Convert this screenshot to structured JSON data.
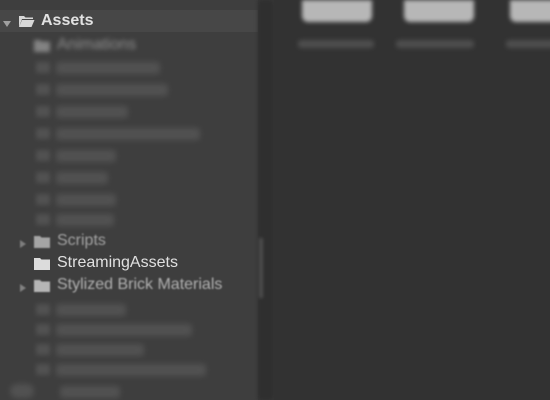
{
  "project_tree": {
    "root": {
      "label": "Assets",
      "expanded": true
    },
    "items": [
      {
        "label": "Animations",
        "blurred": true
      },
      {
        "label": "Scripts",
        "collapsed": true
      },
      {
        "label": "StreamingAssets"
      },
      {
        "label": "Stylized Brick Materials",
        "collapsed": true
      }
    ]
  },
  "colors": {
    "panel_bg": "#3e3e3e",
    "selected_row_bg": "#474747",
    "content_bg": "#323232",
    "text": "#c9c9c9",
    "folder": "#c8c8c8"
  }
}
